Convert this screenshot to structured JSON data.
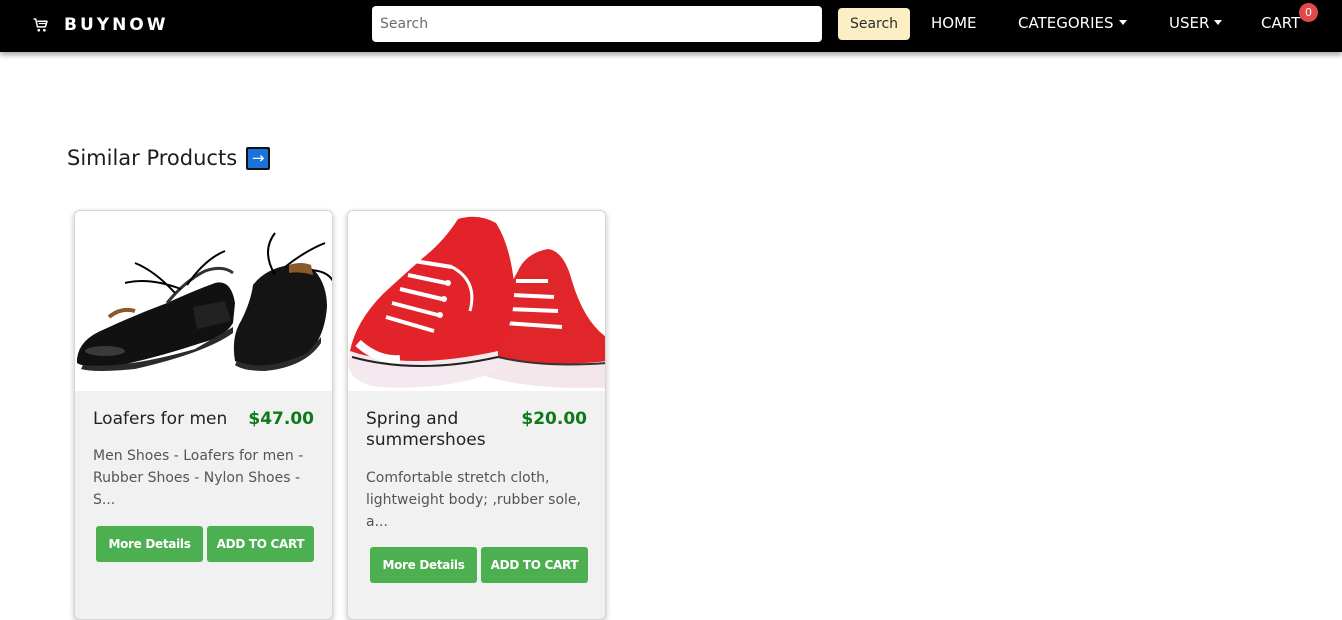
{
  "brand": {
    "name": "BUYNOW",
    "icon": "cart-icon"
  },
  "search": {
    "placeholder": "Search",
    "button_label": "Search"
  },
  "nav": {
    "home": "HOME",
    "categories": "CATEGORIES",
    "user": "USER",
    "cart": "CART",
    "cart_count": "0"
  },
  "section": {
    "title": "Similar Products",
    "arrow": "→"
  },
  "products": [
    {
      "name": "Loafers for men",
      "price": "$47.00",
      "description": "Men Shoes - Loafers for men - Rubber Shoes - Nylon Shoes - S...",
      "details_label": "More Details",
      "cart_label": "ADD TO CART"
    },
    {
      "name": "Spring and summershoes",
      "price": "$20.00",
      "description": "Comfortable stretch cloth, lightweight body; ,rubber sole, a...",
      "details_label": "More Details",
      "cart_label": "ADD TO CART"
    }
  ],
  "colors": {
    "navbar": "#000000",
    "search_button": "#fcefc4",
    "price": "#0d7a1a",
    "button": "#4caf50",
    "badge": "#e04a4a",
    "arrow_box": "#1a73d9"
  }
}
